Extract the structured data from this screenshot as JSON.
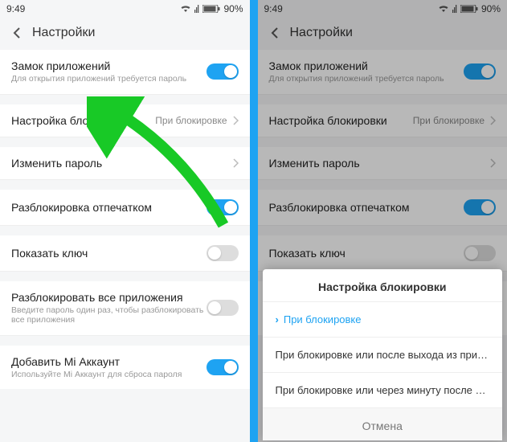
{
  "status": {
    "time": "9:49",
    "battery": "90%"
  },
  "header": {
    "title": "Настройки"
  },
  "items": {
    "appLock": {
      "title": "Замок приложений",
      "sub": "Для открытия приложений требуется пароль"
    },
    "lockSetting": {
      "title": "Настройка блокировки",
      "value": "При блокировке"
    },
    "changePw": {
      "title": "Изменить пароль"
    },
    "fingerprint": {
      "title": "Разблокировка отпечатком"
    },
    "showKey": {
      "title": "Показать ключ"
    },
    "unlockAll": {
      "title": "Разблокировать все приложения",
      "sub": "Введите пароль один раз, чтобы разблокировать все приложения"
    },
    "miAccount": {
      "title": "Добавить Mi Аккаунт",
      "sub": "Используйте Mi Аккаунт для сброса пароля"
    }
  },
  "sheet": {
    "title": "Настройка блокировки",
    "opt1": "При блокировке",
    "opt2": "При блокировке или после выхода из приложения",
    "opt3": "При блокировке или через минуту после выхода из прилож...",
    "cancel": "Отмена"
  }
}
